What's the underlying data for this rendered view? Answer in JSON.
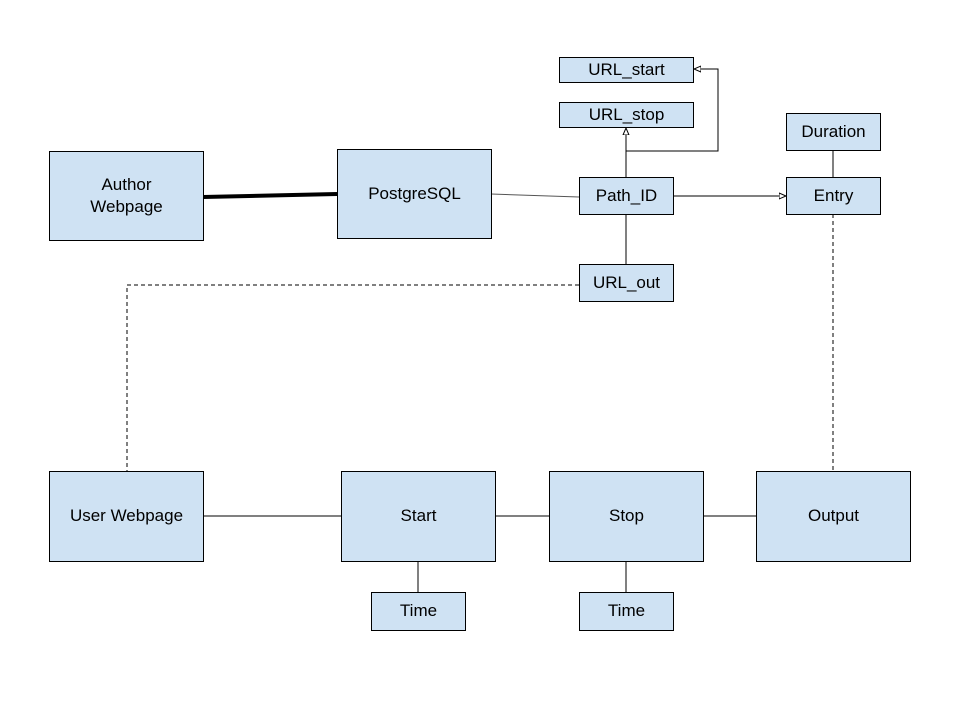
{
  "colors": {
    "box_fill": "#cfe2f3",
    "stroke": "#000000"
  },
  "nodes": {
    "author": "Author\nWebpage",
    "postgres": "PostgreSQL",
    "path_id": "Path_ID",
    "url_start": "URL_start",
    "url_stop": "URL_stop",
    "url_out": "URL_out",
    "duration": "Duration",
    "entry": "Entry",
    "user": "User Webpage",
    "start": "Start",
    "stop": "Stop",
    "output": "Output",
    "time1": "Time",
    "time2": "Time"
  }
}
